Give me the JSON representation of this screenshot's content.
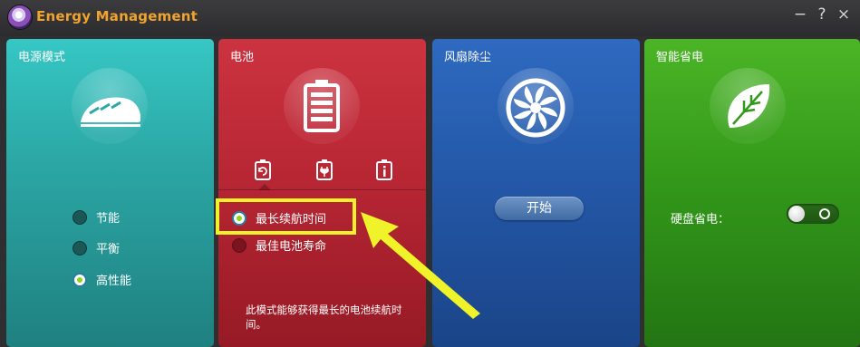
{
  "app": {
    "title": "Energy Management",
    "controls": [
      "−",
      "?",
      "×"
    ]
  },
  "colors": {
    "title_accent": "#f0a32e",
    "power_panel": "#2ba7a5",
    "battery_panel": "#b82634",
    "fan_panel": "#2458a8",
    "eco_panel": "#33991a",
    "annotation": "#f0f22a",
    "selected_dot": "#8fd11e"
  },
  "panels": {
    "power": {
      "title": "电源模式",
      "icon": "bullet-train-icon",
      "options": [
        {
          "label": "节能",
          "selected": false
        },
        {
          "label": "平衡",
          "selected": false
        },
        {
          "label": "高性能",
          "selected": true
        }
      ]
    },
    "battery": {
      "title": "电池",
      "icon": "battery-icon",
      "tabs": [
        "battery-cycle-icon",
        "battery-plug-icon",
        "battery-info-icon"
      ],
      "options": [
        {
          "label": "最长续航时间",
          "selected": true
        },
        {
          "label": "最佳电池寿命",
          "selected": false
        }
      ],
      "description": "此模式能够获得最长的电池续航时间。"
    },
    "fan": {
      "title": "风扇除尘",
      "icon": "fan-icon",
      "start_label": "开始"
    },
    "eco": {
      "title": "智能省电",
      "icon": "leaf-icon",
      "toggle_label": "硬盘省电：",
      "toggle_on": false
    }
  }
}
